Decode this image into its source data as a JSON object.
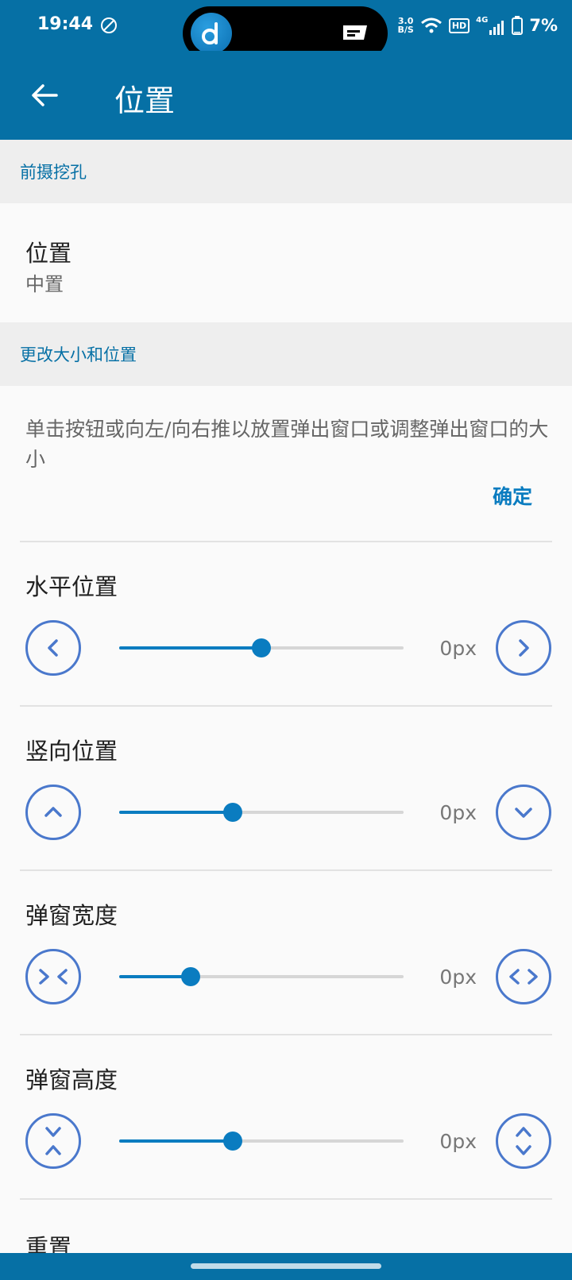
{
  "status_bar": {
    "time": "19:44",
    "net_speed_value": "3.0",
    "net_speed_unit": "B/S",
    "hd_badge": "HD",
    "network_type": "4G",
    "battery": "7%"
  },
  "toolbar": {
    "title": "位置"
  },
  "sections": {
    "cutout": {
      "header": "前摄挖孔",
      "position_title": "位置",
      "position_value": "中置"
    },
    "resize": {
      "header": "更改大小和位置",
      "description": "单击按钮或向左/向右推以放置弹出窗口或调整弹出窗口的大小",
      "confirm_label": "确定"
    }
  },
  "sliders": [
    {
      "title": "水平位置",
      "value": "0px",
      "level": 0.5
    },
    {
      "title": "竖向位置",
      "value": "0px",
      "level": 0.4
    },
    {
      "title": "弹窗宽度",
      "value": "0px",
      "level": 0.25
    },
    {
      "title": "弹窗高度",
      "value": "0px",
      "level": 0.4
    }
  ],
  "reset": {
    "title": "重置"
  },
  "colors": {
    "primary": "#0670a5",
    "accent": "#0a7cc0",
    "icon": "#4a78cc"
  },
  "icons": [
    "back-arrow-icon",
    "chevron-left-icon",
    "chevron-right-icon",
    "chevron-up-icon",
    "chevron-down-icon",
    "shrink-horizontal-icon",
    "expand-horizontal-icon",
    "shrink-vertical-icon",
    "expand-vertical-icon"
  ]
}
